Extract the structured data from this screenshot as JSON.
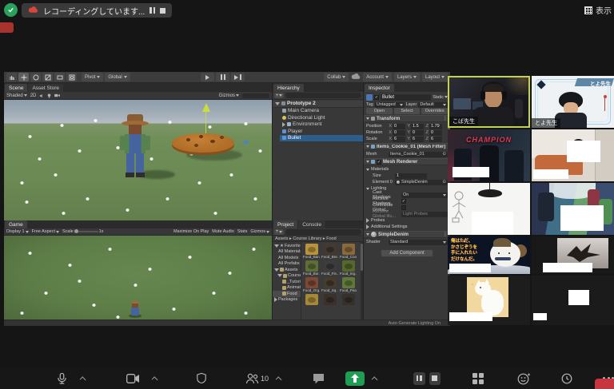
{
  "icons": {
    "caret_down": "▾",
    "caret_right": "▸",
    "kebab": "⋮",
    "check": "✓",
    "star": "★",
    "plus": "+",
    "target": "⊙"
  },
  "topbar": {
    "recording_text": "レコーディングしています...",
    "view_label": "表示"
  },
  "zoom_toolbar": {
    "participants_count": "10"
  },
  "unity": {
    "toolbar": {
      "pivot": "Pivot",
      "global": "Global",
      "collab": "Collab",
      "account": "Account",
      "layers": "Layers",
      "layout": "Layout"
    },
    "scene": {
      "tab": "Scene",
      "tab_secondary": "Asset Store",
      "shading": "Shaded",
      "mode_2d": "2D",
      "gizmos": "Gizmos"
    },
    "game": {
      "tab": "Game",
      "display": "Display 1",
      "aspect": "Free Aspect",
      "scale_label": "Scale",
      "scale_value": "1x",
      "maximize": "Maximize On Play",
      "mute": "Mute Audio",
      "stats": "Stats",
      "gizmos": "Gizmos"
    },
    "hierarchy": {
      "tab": "Hierarchy",
      "items": [
        {
          "label": "Prototype 2"
        },
        {
          "label": "Main Camera"
        },
        {
          "label": "Directional Light"
        },
        {
          "label": "Environment"
        },
        {
          "label": "Player"
        },
        {
          "label": "Bullet"
        }
      ]
    },
    "project": {
      "tab": "Project",
      "console_tab": "Console",
      "breadcrumb": "Assets ▸ Course Library ▸ Food",
      "favorites_label": "Favorites",
      "favorites": [
        "All Materials",
        "All Models",
        "All Prefabs"
      ],
      "assets_label": "Assets",
      "tree": [
        "Course Libr...",
        "_Tutorial",
        "Animations",
        "Food"
      ],
      "packages_label": "Packages",
      "assets": [
        {
          "name": "Food_Ban...",
          "color": "#b8943c"
        },
        {
          "name": "Food_Bre...",
          "color": "#433931"
        },
        {
          "name": "Food_Coo...",
          "color": "#8a6a3b"
        },
        {
          "name": "Food_Bur...",
          "color": "#5d6f36"
        },
        {
          "name": "Food_Fis...",
          "color": "#3c3c3e"
        },
        {
          "name": "Food_Ing...",
          "color": "#57682f"
        },
        {
          "name": "Food_Org...",
          "color": "#7c4935"
        },
        {
          "name": "Food_Sq...",
          "color": "#463b2d"
        },
        {
          "name": "Food_Pea...",
          "color": "#60793a"
        },
        {
          "name": "",
          "color": "#a5883a"
        },
        {
          "name": "",
          "color": "#3a322a"
        },
        {
          "name": "",
          "color": "#35302a"
        }
      ]
    },
    "inspector": {
      "tab": "Inspector",
      "object_name": "Bullet",
      "static_label": "Static",
      "tag_label": "Tag",
      "tag_value": "Untagged",
      "layer_label": "Layer",
      "layer_value": "Default",
      "prefab_open": "Open",
      "prefab_select": "Select",
      "prefab_overrides": "Overrides",
      "axes": [
        "X",
        "Y",
        "Z"
      ],
      "transform": {
        "title": "Transform",
        "position_label": "Position",
        "position": [
          "0",
          "1.5",
          "1.79"
        ],
        "rotation_label": "Rotation",
        "rotation": [
          "0",
          "0",
          "0"
        ],
        "scale_label": "Scale",
        "scale": [
          "6",
          "6",
          "6"
        ]
      },
      "mesh_filter": {
        "title": "Items_Cookie_01 (Mesh Filter)",
        "mesh_label": "Mesh",
        "mesh_value": "Items_Cookie_01"
      },
      "mesh_renderer": {
        "title": "Mesh Renderer",
        "materials_label": "Materials",
        "size_label": "Size",
        "size_value": "1",
        "element_label": "Element 0",
        "element_value": "SimpleDenim",
        "lighting_label": "Lighting",
        "cast_label": "Cast Shadows",
        "cast_value": "On",
        "receive_label": "Receive Shadows",
        "contribute_label": "Contribute Global...",
        "rgi_label": "Receive Global Illu...",
        "rgi_value": "Light Probes",
        "probes_label": "Probes",
        "additional_label": "Additional Settings"
      },
      "material": {
        "name": "SimpleDenim",
        "shader_label": "Shader",
        "shader_value": "Standard"
      },
      "add_component": "Add Component"
    },
    "status_bar": "Auto Generate Lighting On"
  },
  "participants": {
    "tile1_name": "こば先生",
    "tile2_name": "とよ先生",
    "tile2_banner": "とよ先生",
    "tile3_overlay": "CHAMPION",
    "tile7_caption": [
      "俺はただ、",
      "かさじぞうを",
      "手に入れたい",
      "だけなんだ。"
    ]
  }
}
